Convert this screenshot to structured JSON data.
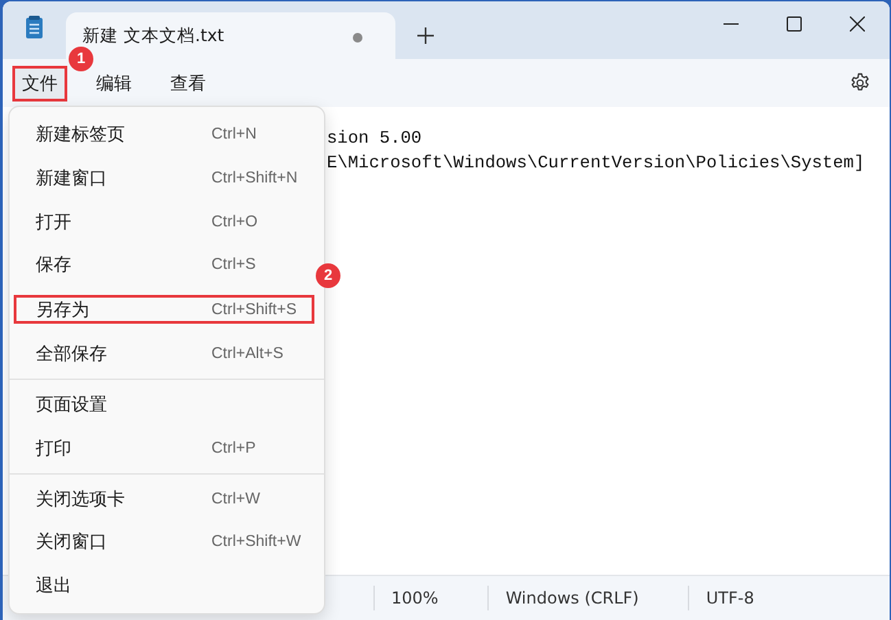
{
  "window": {
    "tab": {
      "title": "新建 文本文档.txt",
      "unsaved": true
    }
  },
  "menubar": [
    {
      "label": "文件",
      "selected": true,
      "callout": "1"
    },
    {
      "label": "编辑",
      "selected": false
    },
    {
      "label": "查看",
      "selected": false
    }
  ],
  "editor": {
    "lines": [
      "sion 5.00",
      "E\\Microsoft\\Windows\\CurrentVersion\\Policies\\System]"
    ]
  },
  "file_menu": {
    "groups": [
      [
        {
          "label": "新建标签页",
          "shortcut": "Ctrl+N"
        },
        {
          "label": "新建窗口",
          "shortcut": "Ctrl+Shift+N"
        },
        {
          "label": "打开",
          "shortcut": "Ctrl+O"
        },
        {
          "label": "保存",
          "shortcut": "Ctrl+S"
        },
        {
          "label": "另存为",
          "shortcut": "Ctrl+Shift+S",
          "callout": "2"
        },
        {
          "label": "全部保存",
          "shortcut": "Ctrl+Alt+S"
        }
      ],
      [
        {
          "label": "页面设置"
        },
        {
          "label": "打印",
          "shortcut": "Ctrl+P"
        }
      ],
      [
        {
          "label": "关闭选项卡",
          "shortcut": "Ctrl+W"
        },
        {
          "label": "关闭窗口",
          "shortcut": "Ctrl+Shift+W"
        },
        {
          "label": "退出"
        }
      ]
    ]
  },
  "status_bar": [
    "100%",
    "Windows (CRLF)",
    "UTF-8"
  ]
}
